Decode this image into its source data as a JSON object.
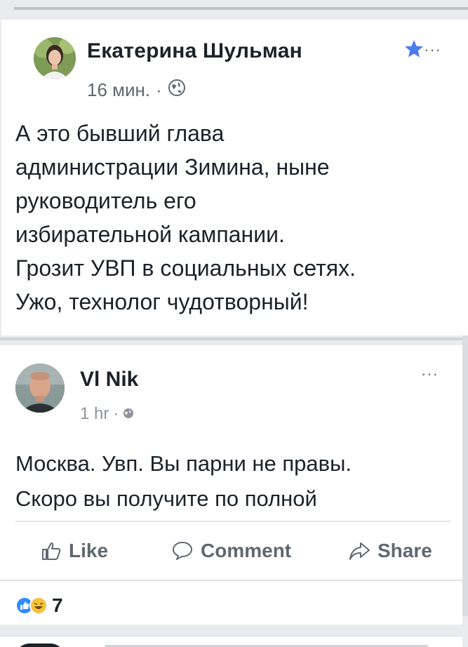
{
  "post1": {
    "author": "Екатерина Шульман",
    "time": "16 мин.",
    "separator": "·",
    "text_lines": [
      "А это бывший глава",
      "администрации Зимина, ныне",
      "руководитель его",
      "избирательной кампании.",
      "Грозит УВП в социальных сетях.",
      "Ужо, технолог чудотворный!"
    ],
    "icons": {
      "privacy": "globe-icon",
      "favorite": "star-icon",
      "menu": "more-icon"
    },
    "more_label": "···"
  },
  "post2": {
    "author": "Vl Nik",
    "time": "1 hr",
    "separator": "·",
    "text_lines": [
      "Москва. Увп. Вы парни не правы.",
      "Скоро вы получите по полной"
    ],
    "more_label": "···",
    "icons": {
      "privacy": "globe-icon",
      "menu": "more-icon"
    },
    "actions": {
      "like": "Like",
      "comment": "Comment",
      "share": "Share"
    },
    "reaction_count": "7",
    "reaction_icons": [
      "like-reaction-icon",
      "haha-reaction-icon"
    ]
  },
  "colors": {
    "star": "#4b7bec",
    "like_reaction": "#2e89ff",
    "haha_reaction": "#f7c23b"
  }
}
